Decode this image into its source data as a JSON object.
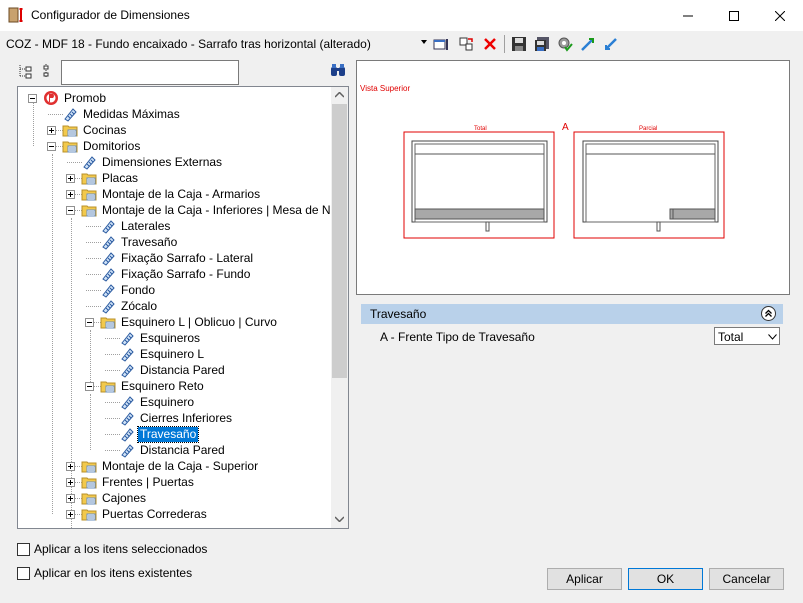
{
  "window": {
    "title": "Configurador de Dimensiones"
  },
  "toolbar": {
    "document_title": "COZ - MDF 18 - Fundo encaixado - Sarrafo tras horizontal (alterado)"
  },
  "search": {
    "value": "",
    "placeholder": ""
  },
  "tree": {
    "nodes": [
      {
        "label": "Promob",
        "icon": "promob-logo-icon"
      },
      {
        "label": "Medidas Máximas",
        "icon": "measure-icon"
      },
      {
        "label": "Cocinas",
        "icon": "folder-icon"
      },
      {
        "label": "Domitorios",
        "icon": "folder-icon"
      },
      {
        "label": "Dimensiones Externas",
        "icon": "measure-icon"
      },
      {
        "label": "Placas",
        "icon": "folder-icon"
      },
      {
        "label": "Montaje de la Caja - Armarios",
        "icon": "folder-icon"
      },
      {
        "label": "Montaje de la Caja - Inferiores | Mesa de Noche",
        "icon": "folder-icon"
      },
      {
        "label": "Laterales",
        "icon": "measure-icon"
      },
      {
        "label": "Travesaño",
        "icon": "measure-icon"
      },
      {
        "label": "Fixação Sarrafo - Lateral",
        "icon": "measure-icon"
      },
      {
        "label": "Fixação Sarrafo - Fundo",
        "icon": "measure-icon"
      },
      {
        "label": "Fondo",
        "icon": "measure-icon"
      },
      {
        "label": "Zócalo",
        "icon": "measure-icon"
      },
      {
        "label": "Esquinero L | Oblicuo | Curvo",
        "icon": "folder-icon"
      },
      {
        "label": "Esquineros",
        "icon": "measure-icon"
      },
      {
        "label": "Esquinero L",
        "icon": "measure-icon"
      },
      {
        "label": "Distancia Pared",
        "icon": "measure-icon"
      },
      {
        "label": "Esquinero Reto",
        "icon": "folder-icon"
      },
      {
        "label": "Esquinero",
        "icon": "measure-icon"
      },
      {
        "label": "Cierres Inferiores",
        "icon": "measure-icon"
      },
      {
        "label": "Travesaño",
        "icon": "measure-icon",
        "selected": true
      },
      {
        "label": "Distancia Pared",
        "icon": "measure-icon"
      },
      {
        "label": "Montaje de la Caja - Superior",
        "icon": "folder-icon"
      },
      {
        "label": "Frentes | Puertas",
        "icon": "folder-icon"
      },
      {
        "label": "Cajones",
        "icon": "folder-icon"
      },
      {
        "label": "Puertas Correderas",
        "icon": "folder-icon"
      }
    ]
  },
  "preview": {
    "view_label": "Vista Superior",
    "marker": "A",
    "left_label": "Total",
    "right_label": "Parcial"
  },
  "properties": {
    "group_title": "Travesaño",
    "rows": [
      {
        "name": "A - Frente Tipo de Travesaño",
        "value": "Total"
      }
    ]
  },
  "options": {
    "apply_selected": "Aplicar a los itens seleccionados",
    "apply_existing": "Aplicar en los itens existentes"
  },
  "buttons": {
    "apply": "Aplicar",
    "ok": "OK",
    "cancel": "Cancelar"
  },
  "colors": {
    "selection": "#0078d7",
    "header": "#b9d1ea",
    "drawing": "#e00000"
  }
}
